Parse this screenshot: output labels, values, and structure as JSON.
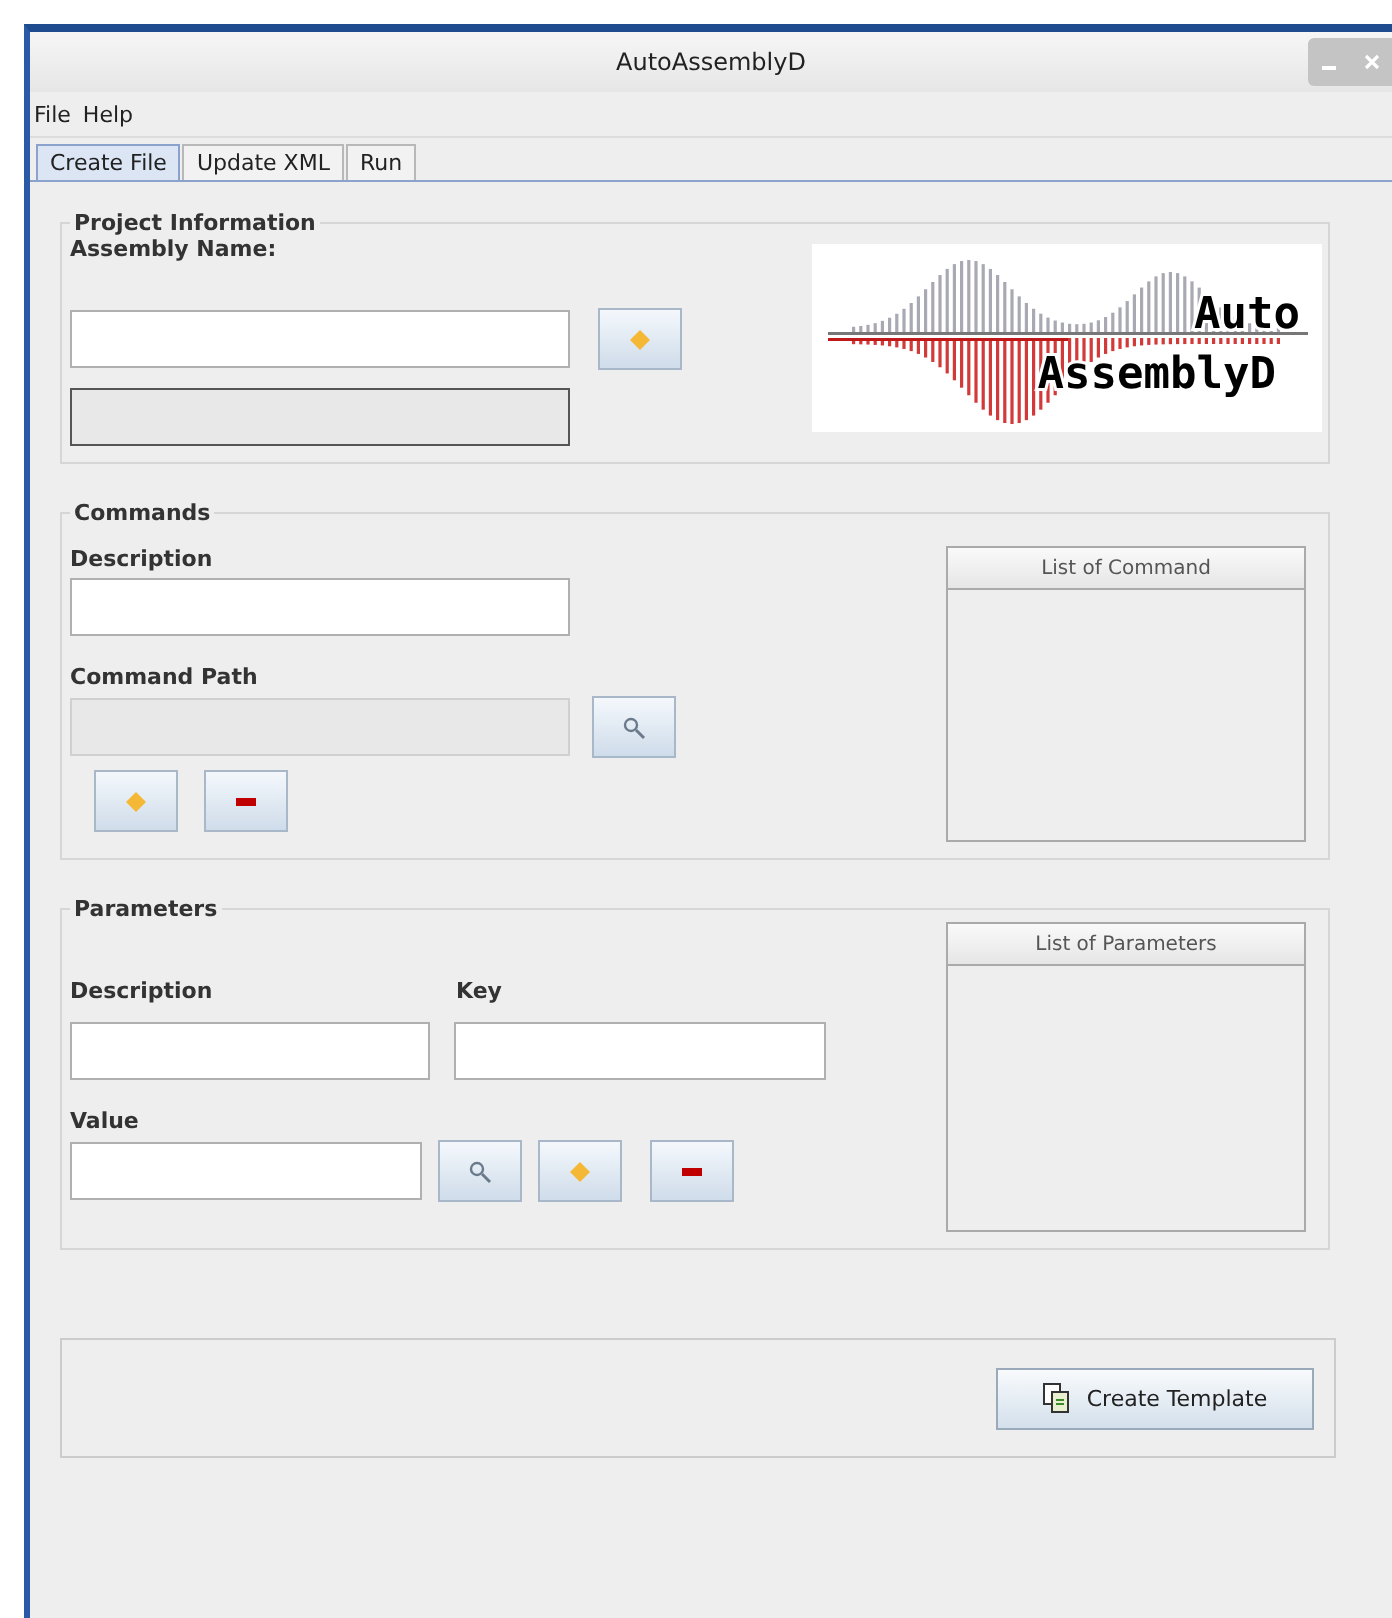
{
  "window": {
    "title": "AutoAssemblyD"
  },
  "menu": [
    {
      "label": "File"
    },
    {
      "label": "Help"
    }
  ],
  "tabs": [
    {
      "label": "Create File",
      "selected": true
    },
    {
      "label": "Update XML",
      "selected": false
    },
    {
      "label": "Run",
      "selected": false
    }
  ],
  "project": {
    "legend": "Project Information",
    "label": "Assembly Name:",
    "fields": [
      {
        "disabled": false
      },
      {
        "disabled": true
      }
    ],
    "logo": {
      "line1": "Auto",
      "line2": "AssemblyD"
    }
  },
  "commands": {
    "legend": "Commands",
    "description_label": "Description",
    "path_label": "Command Path",
    "path_disabled": true,
    "list_header": "List of Command"
  },
  "parameters": {
    "legend": "Parameters",
    "description_label": "Description",
    "key_label": "Key",
    "value_label": "Value",
    "list_header": "List of Parameters"
  },
  "footer": {
    "button": "Create Template"
  }
}
